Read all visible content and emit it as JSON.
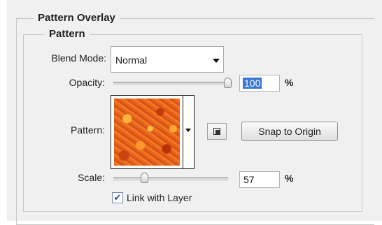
{
  "section": {
    "title": "Pattern Overlay",
    "subsection_title": "Pattern"
  },
  "blend_mode": {
    "label": "Blend Mode:",
    "value": "Normal"
  },
  "opacity": {
    "label": "Opacity:",
    "value": "100",
    "unit": "%",
    "slider_fraction": 1.0
  },
  "pattern": {
    "label": "Pattern:",
    "snap_button": "Snap to Origin"
  },
  "scale": {
    "label": "Scale:",
    "value": "57",
    "unit": "%",
    "slider_fraction": 0.3
  },
  "link_with_layer": {
    "label": "Link with Layer",
    "checked": true
  },
  "icons": {
    "dropdown": "chevron-down-icon",
    "new_preset": "new-preset-icon",
    "checkmark": "checkmark-icon"
  },
  "colors": {
    "selection": "#3a77d6",
    "pattern_main": "#e86a1c"
  }
}
